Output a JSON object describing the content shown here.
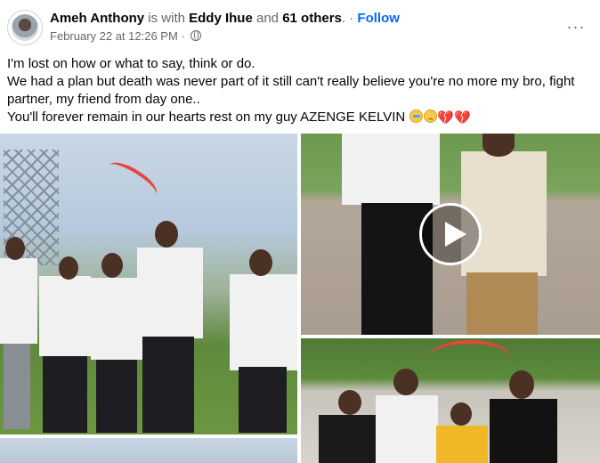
{
  "post": {
    "author": "Ameh Anthony",
    "with_text": "is with",
    "tagged": "Eddy Ihue",
    "and_text": "and",
    "others": "61 others",
    "dot_sep": ".",
    "sep": "·",
    "follow_label": "Follow",
    "date": "February 22 at 12:26 PM",
    "privacy_icon": "globe-icon",
    "more_label": "···",
    "text_lines": [
      "I'm lost on how or what to say, think or do.",
      "We had a plan but death was never part of it still can't really believe you're no more my bro, fight partner, my friend from day one..",
      "You'll forever remain in our hearts rest on my guy AZENGE KELVIN"
    ],
    "emojis": [
      "crying-face",
      "disappointed-face",
      "broken-heart",
      "broken-heart"
    ],
    "broken_heart_glyph": "💔"
  },
  "media": {
    "play_label": "Play video"
  }
}
